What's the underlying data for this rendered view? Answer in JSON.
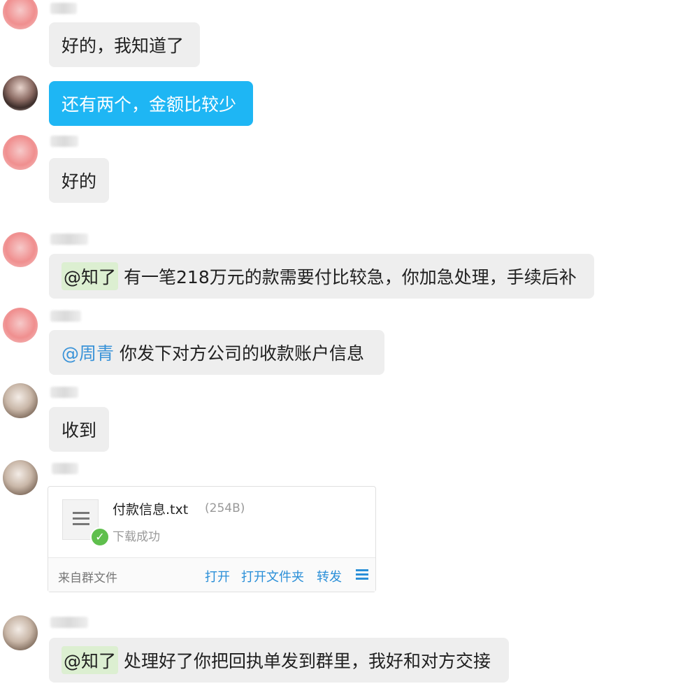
{
  "messages": [
    {
      "text": "好的，我知道了"
    },
    {
      "text": "还有两个，金额比较少"
    },
    {
      "text": "好的"
    },
    {
      "mention": "@知了",
      "text": "有一笔218万元的款需要付比较急，你加急处理，手续后补"
    },
    {
      "mention": "@周青",
      "text": "你发下对方公司的收款账户信息"
    },
    {
      "text": "收到"
    },
    {
      "mention": "@知了",
      "text": "处理好了你把回执单发到群里，我好和对方交接"
    }
  ],
  "file": {
    "name": "付款信息.txt",
    "size": "(254B)",
    "status": "下载成功",
    "source": "来自群文件",
    "actions": {
      "open": "打开",
      "open_folder": "打开文件夹",
      "forward": "转发"
    },
    "icon": "document-icon",
    "status_icon": "check-circle-icon",
    "menu_icon": "menu-icon"
  },
  "colors": {
    "self_bubble": "#1eb6f4",
    "other_bubble": "#eeeeee",
    "mention_highlight": "#dcefd1",
    "mention_link": "#3a93d8",
    "action_link": "#2a8fd8",
    "success": "#5fbf4d"
  }
}
